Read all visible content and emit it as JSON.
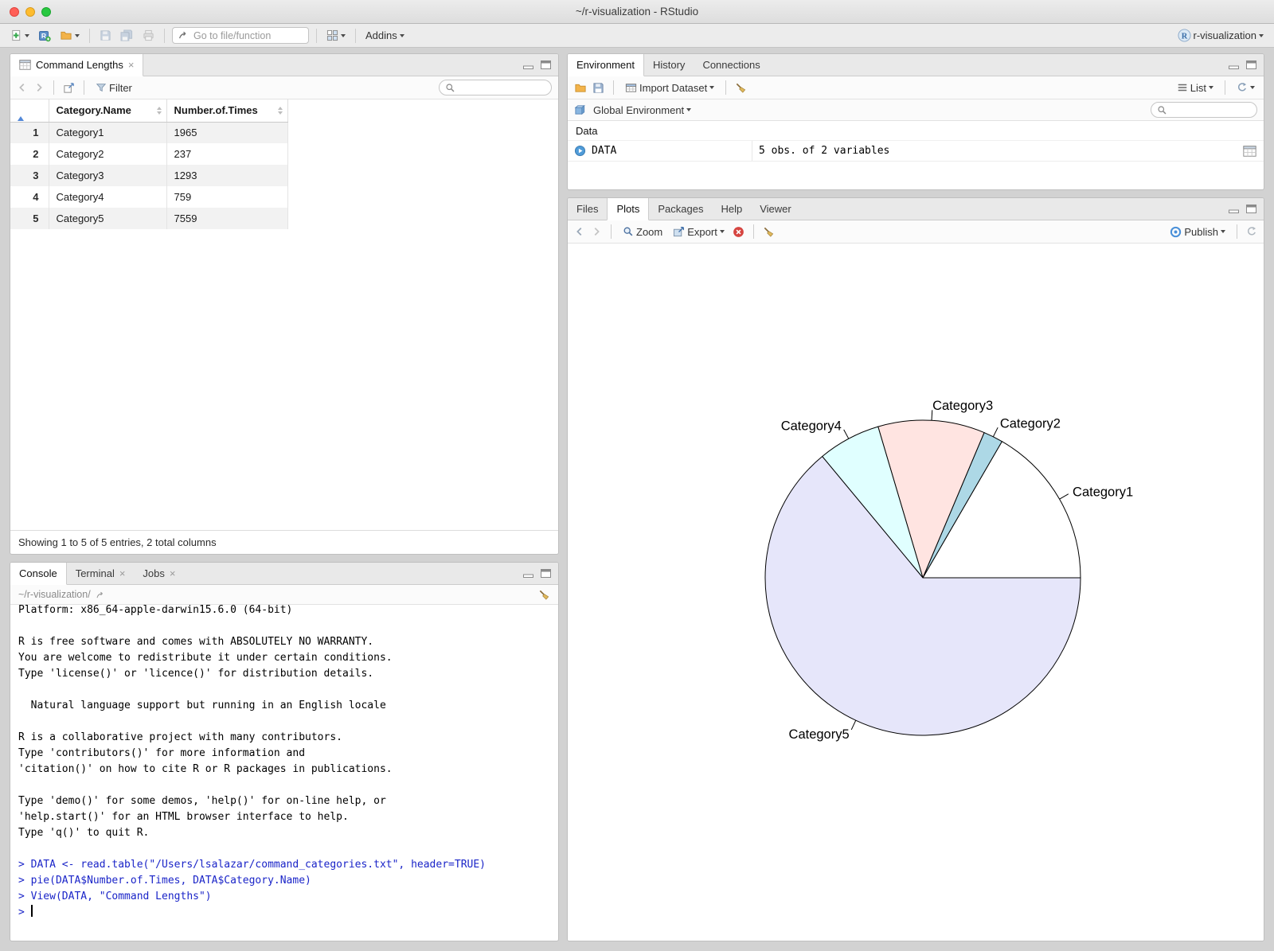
{
  "window": {
    "title": "~/r-visualization - RStudio"
  },
  "toolbar": {
    "goto_placeholder": "Go to file/function",
    "addins_label": "Addins",
    "project_label": "r-visualization"
  },
  "viewer": {
    "tab_label": "Command Lengths",
    "filter_label": "Filter",
    "columns": [
      "Category.Name",
      "Number.of.Times"
    ],
    "rows": [
      [
        "1",
        "Category1",
        "1965"
      ],
      [
        "2",
        "Category2",
        "237"
      ],
      [
        "3",
        "Category3",
        "1293"
      ],
      [
        "4",
        "Category4",
        "759"
      ],
      [
        "5",
        "Category5",
        "7559"
      ]
    ],
    "footer": "Showing 1 to 5 of 5 entries, 2 total columns"
  },
  "console": {
    "tabs": [
      "Console",
      "Terminal",
      "Jobs"
    ],
    "path": "~/r-visualization/",
    "lines": [
      {
        "type": "out",
        "text": "Platform: x86_64-apple-darwin15.6.0 (64-bit)"
      },
      {
        "type": "out",
        "text": ""
      },
      {
        "type": "out",
        "text": "R is free software and comes with ABSOLUTELY NO WARRANTY."
      },
      {
        "type": "out",
        "text": "You are welcome to redistribute it under certain conditions."
      },
      {
        "type": "out",
        "text": "Type 'license()' or 'licence()' for distribution details."
      },
      {
        "type": "out",
        "text": ""
      },
      {
        "type": "out",
        "text": "  Natural language support but running in an English locale"
      },
      {
        "type": "out",
        "text": ""
      },
      {
        "type": "out",
        "text": "R is a collaborative project with many contributors."
      },
      {
        "type": "out",
        "text": "Type 'contributors()' for more information and"
      },
      {
        "type": "out",
        "text": "'citation()' on how to cite R or R packages in publications."
      },
      {
        "type": "out",
        "text": ""
      },
      {
        "type": "out",
        "text": "Type 'demo()' for some demos, 'help()' for on-line help, or"
      },
      {
        "type": "out",
        "text": "'help.start()' for an HTML browser interface to help."
      },
      {
        "type": "out",
        "text": "Type 'q()' to quit R."
      },
      {
        "type": "out",
        "text": ""
      },
      {
        "type": "in",
        "text": "> DATA <- read.table(\"/Users/lsalazar/command_categories.txt\", header=TRUE)"
      },
      {
        "type": "in",
        "text": "> pie(DATA$Number.of.Times, DATA$Category.Name)"
      },
      {
        "type": "in",
        "text": "> View(DATA, \"Command Lengths\")"
      },
      {
        "type": "prompt",
        "text": "> "
      }
    ]
  },
  "environment": {
    "tabs": [
      "Environment",
      "History",
      "Connections"
    ],
    "import_label": "Import Dataset",
    "list_label": "List",
    "scope_label": "Global Environment",
    "section_label": "Data",
    "object": {
      "name": "DATA",
      "desc": "5 obs. of 2 variables"
    }
  },
  "plots": {
    "tabs": [
      "Files",
      "Plots",
      "Packages",
      "Help",
      "Viewer"
    ],
    "zoom_label": "Zoom",
    "export_label": "Export",
    "publish_label": "Publish"
  },
  "icons": {
    "close": "×"
  },
  "chart_data": {
    "type": "pie",
    "title": "",
    "labels": [
      "Category1",
      "Category2",
      "Category3",
      "Category4",
      "Category5"
    ],
    "values": [
      1965,
      237,
      1293,
      759,
      7559
    ],
    "colors": [
      "#ffffff",
      "#add8e6",
      "#ffe4e1",
      "#e0ffff",
      "#e6e6fa"
    ],
    "stroke": "#000000",
    "start_angle_deg": 0,
    "direction": "counterclockwise",
    "legend": "none"
  }
}
